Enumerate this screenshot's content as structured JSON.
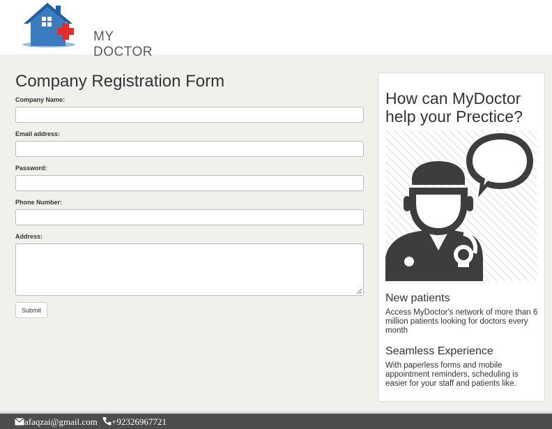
{
  "header": {
    "logo_text": "MY DOCTOR"
  },
  "form": {
    "title": "Company Registration Form",
    "fields": {
      "company_name": {
        "label": "Company Name:",
        "value": ""
      },
      "email": {
        "label": "Email address:",
        "value": ""
      },
      "password": {
        "label": "Password:",
        "value": ""
      },
      "phone": {
        "label": "Phone Number:",
        "value": ""
      },
      "address": {
        "label": "Address:",
        "value": ""
      }
    },
    "submit_label": "Submit"
  },
  "panel": {
    "title": "How can MyDoctor help your Prectice?",
    "features": [
      {
        "title": "New patients",
        "text": "Access MyDoctor's network of more than 6 million patients looking for doctors every month"
      },
      {
        "title": "Seamless Experience",
        "text": "With paperless forms and mobile appointment reminders, scheduling is easier for your staff and patients like."
      }
    ]
  },
  "footer": {
    "email": "afaqzai@gmail.com",
    "phone": "+92326967721",
    "email_icon": "envelope-icon",
    "phone_icon": "phone-icon"
  },
  "colors": {
    "page_bg": "#f0f0ed",
    "footer_bg": "#4d4d4d",
    "logo_blue": "#3b7cc0",
    "logo_red": "#e52b2b",
    "illustration_dark": "#3d3d3f"
  }
}
